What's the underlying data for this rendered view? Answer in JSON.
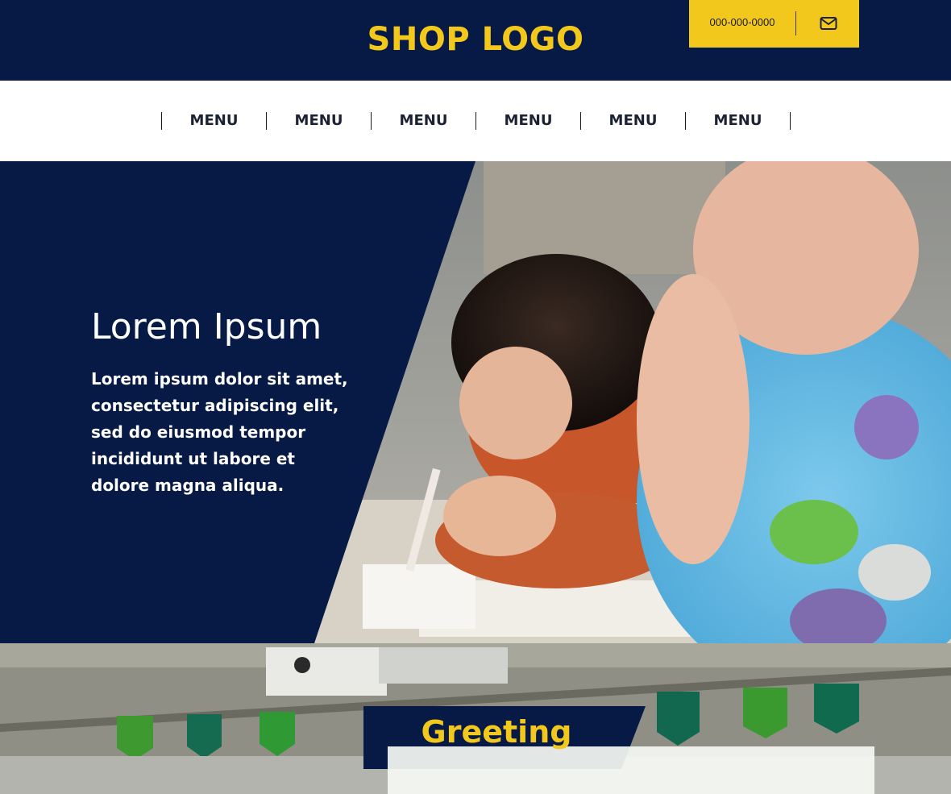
{
  "header": {
    "logo": "SHOP LOGO",
    "phone": "000-000-0000",
    "mail_icon": "envelope-icon"
  },
  "nav": {
    "items": [
      {
        "label": "MENU"
      },
      {
        "label": "MENU"
      },
      {
        "label": "MENU"
      },
      {
        "label": "MENU"
      },
      {
        "label": "MENU"
      },
      {
        "label": "MENU"
      }
    ]
  },
  "hero": {
    "title": "Lorem Ipsum",
    "text": "Lorem ipsum dolor sit amet, consectetur adipiscing elit, sed do eiusmod tempor incididunt ut labore et dolore magna aliqua."
  },
  "greeting": {
    "title": "Greeting"
  },
  "colors": {
    "navy": "#061a45",
    "accent_yellow": "#f2c81d",
    "white": "#ffffff"
  }
}
